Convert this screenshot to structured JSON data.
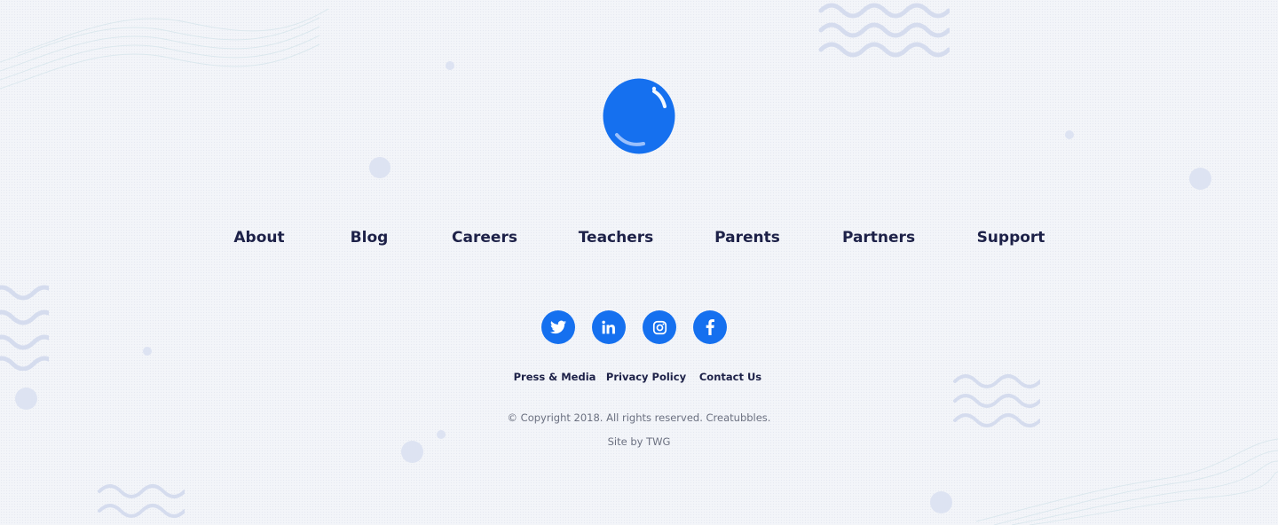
{
  "brand": {
    "logo": "bubble-logo",
    "accent": "#1570ef",
    "text_color": "#1d2148"
  },
  "nav": {
    "items": [
      {
        "label": "About"
      },
      {
        "label": "Blog"
      },
      {
        "label": "Careers"
      },
      {
        "label": "Teachers"
      },
      {
        "label": "Parents"
      },
      {
        "label": "Partners"
      },
      {
        "label": "Support"
      }
    ]
  },
  "social": [
    {
      "icon": "twitter-icon"
    },
    {
      "icon": "linkedin-icon"
    },
    {
      "icon": "instagram-icon"
    },
    {
      "icon": "facebook-icon"
    }
  ],
  "legal_links": [
    {
      "label": "Press & Media"
    },
    {
      "label": "Privacy Policy"
    },
    {
      "label": "Contact Us"
    }
  ],
  "footer": {
    "copyright": "© Copyright 2018. All rights reserved. Creatubbles.",
    "credit": "Site by TWG"
  }
}
